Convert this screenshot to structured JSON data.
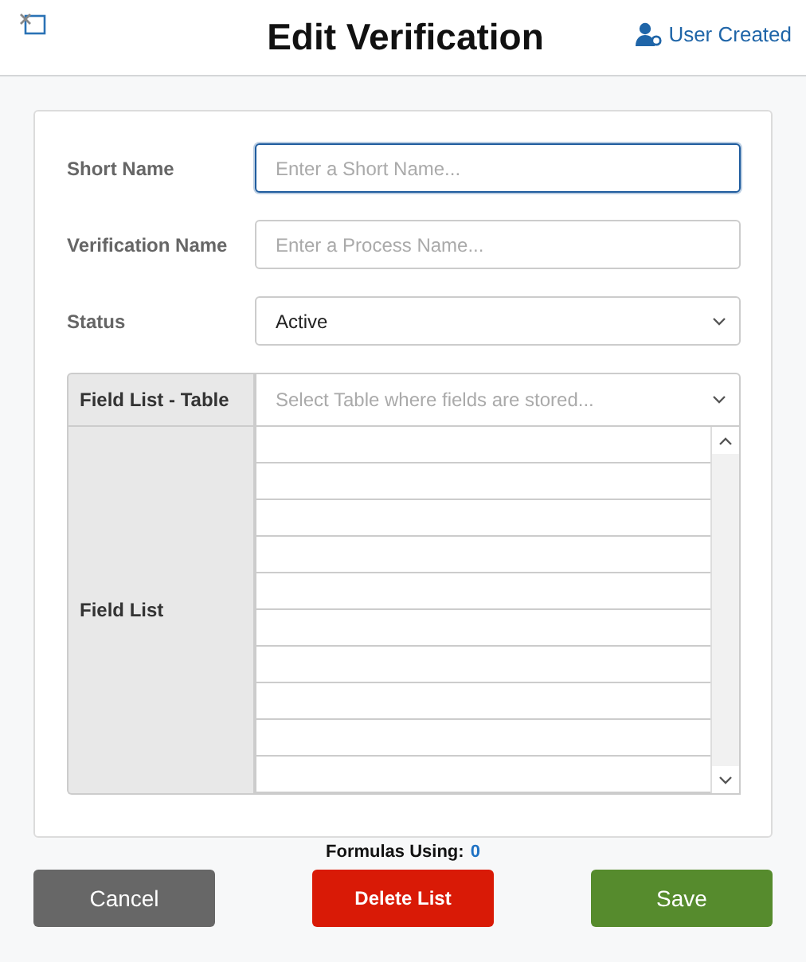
{
  "header": {
    "title": "Edit Verification",
    "badge": "User Created"
  },
  "fields": [
    {
      "kind": "text",
      "label": "Short Name",
      "placeholder": "Enter a Short Name...",
      "focused": true
    },
    {
      "kind": "text",
      "label": "Verification Name",
      "placeholder": "Enter a Process Name...",
      "focused": false
    },
    {
      "kind": "select",
      "label": "Status",
      "value": "Active",
      "focused": false
    }
  ],
  "field_list_table": {
    "label": "Field List - Table",
    "placeholder": "Select Table where fields are stored..."
  },
  "field_list": {
    "label": "Field List"
  },
  "formulas": {
    "label": "Formulas Using:",
    "count": "0"
  },
  "buttons": [
    {
      "kind": "neutral",
      "label": "Cancel"
    },
    {
      "kind": "danger",
      "label": "Delete List"
    },
    {
      "kind": "primary",
      "label": "Save"
    }
  ]
}
